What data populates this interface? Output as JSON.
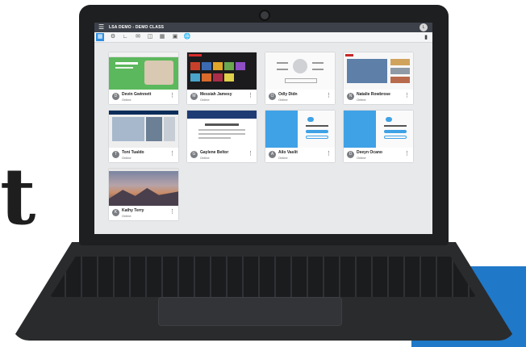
{
  "background": {
    "glyph": "t",
    "accent_color": "#1f78c8"
  },
  "app": {
    "class_title": "LSA DEMO - DEMO CLASS",
    "user_initial": "L",
    "topbar_color": "#3d4149",
    "active_color": "#2f8fe0"
  },
  "toolbar": {
    "icons": [
      "grid-icon",
      "gear-icon",
      "share-icon",
      "mail-icon",
      "view-icon",
      "calendar-icon",
      "display-icon",
      "globe-icon"
    ],
    "chat_icon": "chat-icon"
  },
  "students": [
    {
      "name": "Devin Gwinnett",
      "initial": "D",
      "status": "Online",
      "thumb": "green-site"
    },
    {
      "name": "Messiah Jamesy",
      "initial": "M",
      "status": "Online",
      "thumb": "dark-store"
    },
    {
      "name": "Odly Didn",
      "initial": "O",
      "status": "Online",
      "thumb": "wikipedia"
    },
    {
      "name": "Natalie Rowbrose",
      "initial": "N",
      "status": "Online",
      "thumb": "news-site"
    },
    {
      "name": "Toni Tualdo",
      "initial": "T",
      "status": "Online",
      "thumb": "photo-site"
    },
    {
      "name": "Gaylene Beltor",
      "initial": "G",
      "status": "Online",
      "thumb": "form-page"
    },
    {
      "name": "Ailo Vaslit",
      "initial": "A",
      "status": "Online",
      "thumb": "twitter-login"
    },
    {
      "name": "Deeyn Ocano",
      "initial": "D",
      "status": "Online",
      "thumb": "twitter-login"
    },
    {
      "name": "Kathy Terry",
      "initial": "K",
      "status": "Online",
      "thumb": "mountain-desktop"
    }
  ]
}
